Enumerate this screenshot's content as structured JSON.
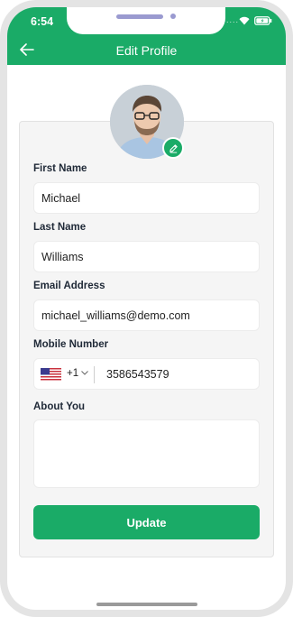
{
  "status_bar": {
    "time": "6:54",
    "signal_dots": "....",
    "wifi_icon": "wifi-icon",
    "battery_icon": "battery-charging-icon"
  },
  "header": {
    "title": "Edit Profile",
    "back_icon": "arrow-left-icon",
    "background_color": "#1aab67"
  },
  "profile": {
    "avatar": "avatar-photo",
    "edit_icon": "pencil-icon"
  },
  "form": {
    "first_name": {
      "label": "First Name",
      "value": "Michael"
    },
    "last_name": {
      "label": "Last Name",
      "value": "Williams"
    },
    "email": {
      "label": "Email Address",
      "value": "michael_williams@demo.com"
    },
    "mobile": {
      "label": "Mobile Number",
      "flag_icon": "us-flag-icon",
      "country_code": "+1",
      "value": "3586543579"
    },
    "about": {
      "label": "About You",
      "value": ""
    }
  },
  "actions": {
    "update_label": "Update",
    "accent_color": "#1aab67"
  }
}
